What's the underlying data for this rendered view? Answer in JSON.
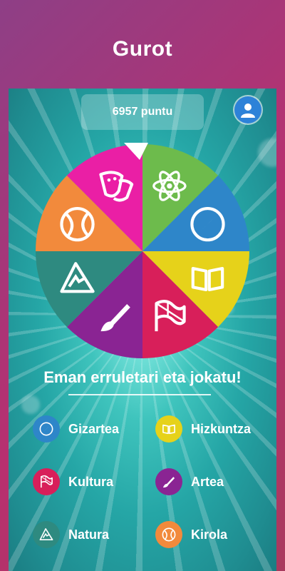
{
  "header": {
    "title": "Gurot"
  },
  "score": {
    "text": "6957 puntu"
  },
  "prompt": "Eman erruletari eta jokatu!",
  "categories": [
    {
      "label": "Gizartea",
      "color": "#2e86c9",
      "icon": "compass-icon"
    },
    {
      "label": "Hizkuntza",
      "color": "#e6d21a",
      "icon": "book-icon"
    },
    {
      "label": "Kultura",
      "color": "#d81f5a",
      "icon": "flag-icon"
    },
    {
      "label": "Artea",
      "color": "#8a2493",
      "icon": "brush-icon"
    },
    {
      "label": "Natura",
      "color": "#2e8a80",
      "icon": "mountain-icon"
    },
    {
      "label": "Kirola",
      "color": "#f28a3c",
      "icon": "ball-icon"
    }
  ],
  "wheel": {
    "segments": [
      {
        "name": "science",
        "color": "#6dbb4c",
        "icon": "atom-icon"
      },
      {
        "name": "gizartea",
        "color": "#2e86c9",
        "icon": "compass-icon"
      },
      {
        "name": "hizkuntza",
        "color": "#e6d21a",
        "icon": "book-icon"
      },
      {
        "name": "kultura",
        "color": "#d81f5a",
        "icon": "flag-icon"
      },
      {
        "name": "artea",
        "color": "#8a2493",
        "icon": "brush-icon"
      },
      {
        "name": "natura",
        "color": "#2e8a80",
        "icon": "mountain-icon"
      },
      {
        "name": "kirola",
        "color": "#f28a3c",
        "icon": "ball-icon"
      },
      {
        "name": "theater",
        "color": "#ea1fa5",
        "icon": "theater-masks-icon"
      }
    ]
  }
}
